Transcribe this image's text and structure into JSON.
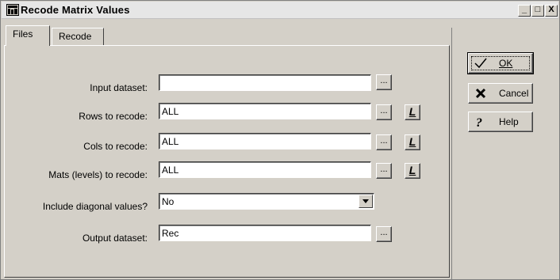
{
  "window": {
    "title": "Recode Matrix Values",
    "controls": {
      "minimize": "_",
      "maximize": "□",
      "close": "X"
    }
  },
  "tabs": [
    {
      "label": "Files",
      "active": true
    },
    {
      "label": "Recode",
      "active": false
    }
  ],
  "form": {
    "input_dataset": {
      "label": "Input dataset:",
      "value": ""
    },
    "rows": {
      "label": "Rows to recode:",
      "value": "ALL"
    },
    "cols": {
      "label": "Cols to recode:",
      "value": "ALL"
    },
    "mats": {
      "label": "Mats (levels) to recode:",
      "value": "ALL"
    },
    "diagonal": {
      "label": "Include diagonal values?",
      "value": "No"
    },
    "output_dataset": {
      "label": "Output dataset:",
      "value": "Rec"
    },
    "browse_label": "...",
    "list_label": "L"
  },
  "buttons": {
    "ok": {
      "label": "OK",
      "icon": "checkmark-icon"
    },
    "cancel": {
      "label": "Cancel",
      "icon": "x-mark-icon"
    },
    "help": {
      "label": "Help",
      "icon": "question-mark-icon"
    }
  }
}
